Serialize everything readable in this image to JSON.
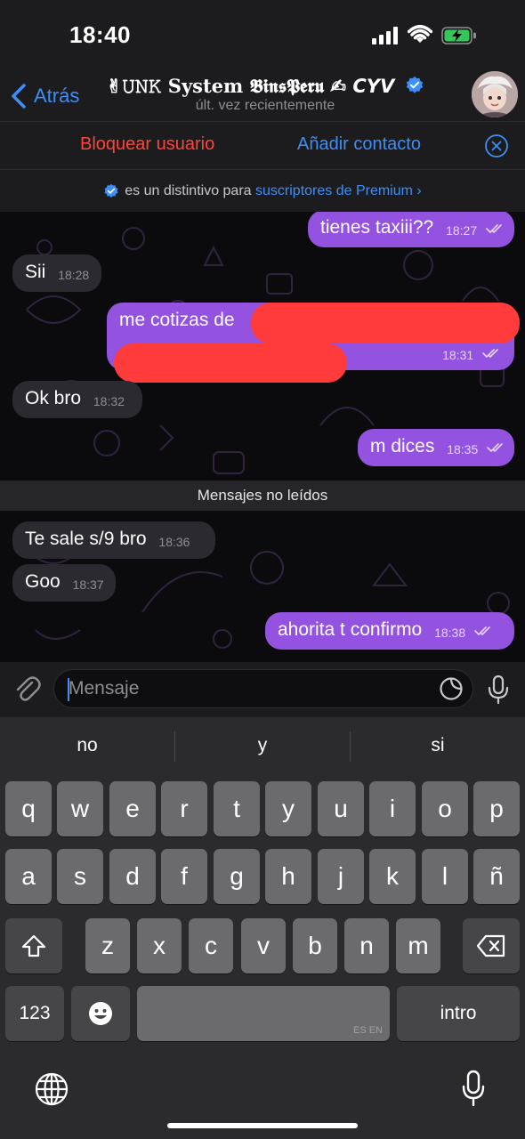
{
  "status_bar": {
    "time": "18:40"
  },
  "header": {
    "back_label": "Atrás",
    "title": "✌︎𝚄𝙽𝙺 𝐒𝐲𝐬𝐭𝐞𝐦 𝕭𝖎𝖓𝖘𝕻𝖊𝖗𝖚 ✍︎ 𝘾𝙔𝙑",
    "subtitle": "últ. vez recientemente"
  },
  "actions": {
    "block_label": "Bloquear usuario",
    "add_label": "Añadir contacto"
  },
  "premium_notice": {
    "prefix": "es un distintivo para",
    "link": "suscriptores de Premium",
    "chevron": "›"
  },
  "messages": [
    {
      "direction": "out",
      "text": "tienes taxiii??",
      "time": "18:27"
    },
    {
      "direction": "in",
      "text": "Sii",
      "time": "18:28"
    },
    {
      "direction": "out",
      "text": "me cotizas de",
      "time": "18:31"
    },
    {
      "direction": "in",
      "text": "Ok bro",
      "time": "18:32"
    },
    {
      "direction": "out",
      "text": "m dices",
      "time": "18:35"
    },
    {
      "direction": "in",
      "text": "Te sale s/9 bro",
      "time": "18:36"
    },
    {
      "direction": "in",
      "text": "Goo",
      "time": "18:37"
    },
    {
      "direction": "out",
      "text": "ahorita t confirmo",
      "time": "18:38"
    }
  ],
  "unread_divider": "Mensajes no leídos",
  "composer": {
    "placeholder": "Mensaje"
  },
  "keyboard": {
    "suggestions": [
      "no",
      "y",
      "si"
    ],
    "row1": [
      "q",
      "w",
      "e",
      "r",
      "t",
      "y",
      "u",
      "i",
      "o",
      "p"
    ],
    "row2": [
      "a",
      "s",
      "d",
      "f",
      "g",
      "h",
      "j",
      "k",
      "l",
      "ñ"
    ],
    "row3": [
      "z",
      "x",
      "c",
      "v",
      "b",
      "n",
      "m"
    ],
    "numbers_label": "123",
    "space_language": "ES EN",
    "return_label": "intro"
  },
  "colors": {
    "accent_blue": "#3e8ef7",
    "danger_red": "#ff453a",
    "outgoing_bubble": "#9353e0",
    "incoming_bubble": "#2b2a30",
    "redaction": "#ff3b3b"
  }
}
